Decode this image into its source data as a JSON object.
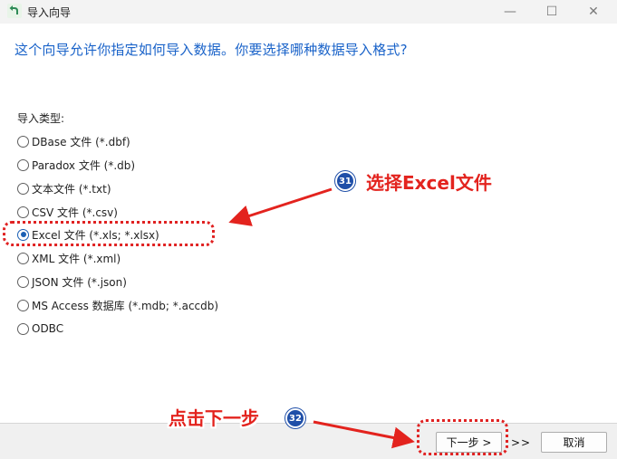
{
  "window": {
    "title": "导入向导",
    "minimize_glyph": "—",
    "maximize_glyph": "☐",
    "close_glyph": "✕"
  },
  "heading": "这个向导允许你指定如何导入数据。你要选择哪种数据导入格式?",
  "import_types": {
    "label": "导入类型:",
    "options": [
      {
        "label": "DBase 文件 (*.dbf)",
        "checked": false
      },
      {
        "label": "Paradox 文件 (*.db)",
        "checked": false
      },
      {
        "label": "文本文件 (*.txt)",
        "checked": false
      },
      {
        "label": "CSV 文件 (*.csv)",
        "checked": false
      },
      {
        "label": "Excel 文件 (*.xls; *.xlsx)",
        "checked": true
      },
      {
        "label": "XML 文件 (*.xml)",
        "checked": false
      },
      {
        "label": "JSON 文件 (*.json)",
        "checked": false
      },
      {
        "label": "MS Access 数据库 (*.mdb; *.accdb)",
        "checked": false
      },
      {
        "label": "ODBC",
        "checked": false
      }
    ]
  },
  "footer": {
    "next_label": "下一步 >",
    "skip_label": ">>",
    "cancel_label": "取消"
  },
  "annotations": {
    "step31": {
      "number": "31",
      "text": "选择Excel文件"
    },
    "step32": {
      "number": "32",
      "text": "点击下一步"
    },
    "color": "#e3231e",
    "badge_color": "#1f4fa8"
  },
  "icons": {
    "app": "back-arrow-icon"
  }
}
